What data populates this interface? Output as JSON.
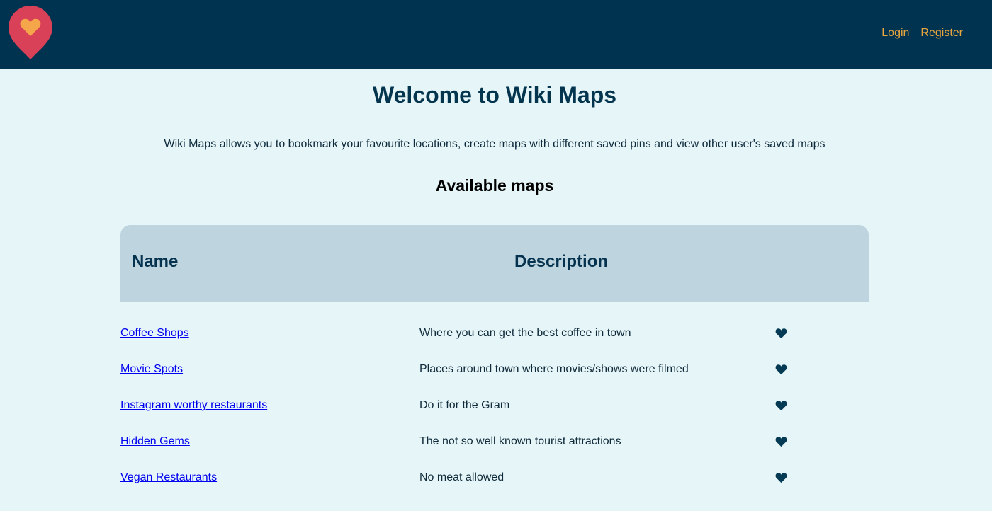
{
  "header": {
    "logo_icon": "map-pin-heart-icon",
    "nav": {
      "login": "Login",
      "register": "Register"
    }
  },
  "main": {
    "title": "Welcome to Wiki Maps",
    "intro": "Wiki Maps allows you to bookmark your favourite locations, create maps with different saved pins and view other user's saved maps",
    "section_title": "Available maps",
    "table": {
      "headers": {
        "name": "Name",
        "description": "Description"
      },
      "rows": [
        {
          "name": "Coffee Shops",
          "description": "Where you can get the best coffee in town",
          "icon": "heart-icon"
        },
        {
          "name": "Movie Spots",
          "description": "Places around town where movies/shows were filmed",
          "icon": "heart-icon"
        },
        {
          "name": "Instagram worthy restaurants",
          "description": "Do it for the Gram",
          "icon": "heart-icon"
        },
        {
          "name": "Hidden Gems",
          "description": "The not so well known tourist attractions",
          "icon": "heart-icon"
        },
        {
          "name": "Vegan Restaurants",
          "description": "No meat allowed",
          "icon": "heart-icon"
        }
      ]
    }
  },
  "colors": {
    "navbar": "#003350",
    "page_bg": "#e6f5f7",
    "accent": "#e9a63f",
    "pin": "#d94158",
    "table_header": "#bed5df",
    "link": "#0000ee"
  }
}
